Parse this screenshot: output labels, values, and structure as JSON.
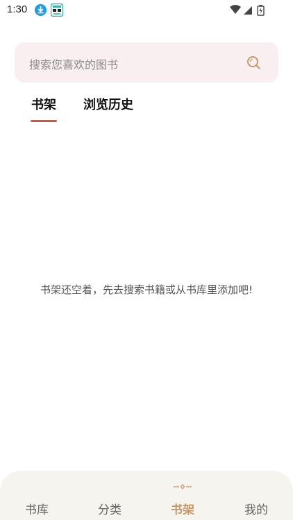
{
  "status_bar": {
    "time": "1:30",
    "icons": [
      "download-icon",
      "app-icon",
      "wifi-icon",
      "signal-icon",
      "battery-icon"
    ]
  },
  "search": {
    "placeholder": "搜索您喜欢的图书",
    "icon": "search-icon",
    "accent": "#c49a6c"
  },
  "tabs": [
    {
      "label": "书架",
      "active": true
    },
    {
      "label": "浏览历史",
      "active": false
    }
  ],
  "tab_indicator_color": "#d9514a",
  "empty_state": {
    "message": "书架还空着，先去搜索书籍或从书库里添加吧!"
  },
  "bottom_nav": {
    "items": [
      {
        "label": "书库",
        "active": false
      },
      {
        "label": "分类",
        "active": false
      },
      {
        "label": "书架",
        "active": true
      },
      {
        "label": "我的",
        "active": false
      }
    ],
    "active_color": "#c49a6c"
  }
}
